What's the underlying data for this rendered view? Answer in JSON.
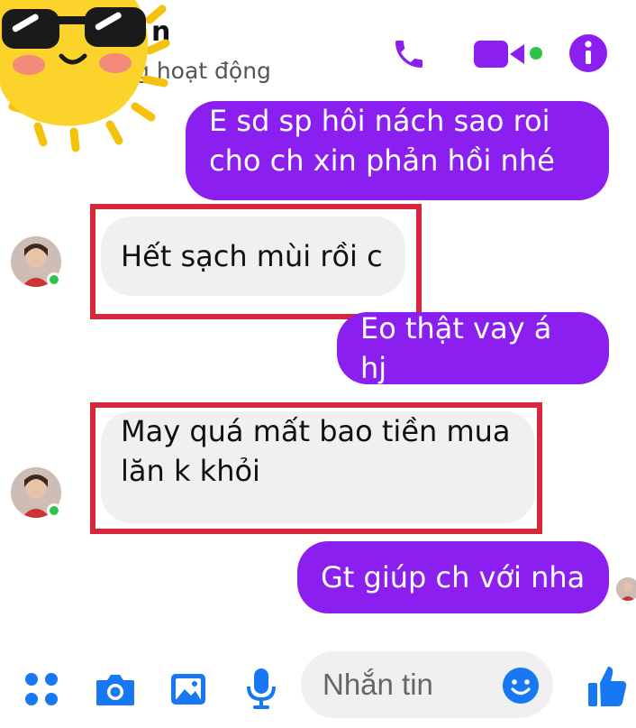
{
  "header": {
    "contact_name": "n",
    "status": "g hoạt động",
    "icons": [
      "phone-icon",
      "video-call-icon",
      "info-icon"
    ],
    "accent_color": "#8a1ff0",
    "online_color": "#2bc44a"
  },
  "sticker": {
    "name": "sun-sunglasses-sticker"
  },
  "messages": [
    {
      "direction": "out",
      "lines": [
        "E sd sp hôi nách sao roi",
        "cho ch xin phản hồi nhé"
      ]
    },
    {
      "direction": "in",
      "lines": [
        "Hết sạch mùi rồi c"
      ],
      "highlighted": true
    },
    {
      "direction": "out",
      "lines": [
        "Eo thật vay á hj"
      ]
    },
    {
      "direction": "in",
      "lines": [
        "May quá mất bao tiền mua",
        "lăn k khỏi"
      ],
      "highlighted": true
    },
    {
      "direction": "out",
      "lines": [
        "Gt giúp ch với nha"
      ]
    }
  ],
  "composer": {
    "placeholder": "Nhắn tin",
    "icons": [
      "apps-icon",
      "camera-icon",
      "image-icon",
      "microphone-icon",
      "emoji-icon",
      "like-icon"
    ]
  },
  "colors": {
    "outgoing_bubble": "#8a1ff0",
    "incoming_bubble": "#f0f0f2",
    "highlight_border": "#d6273d"
  }
}
